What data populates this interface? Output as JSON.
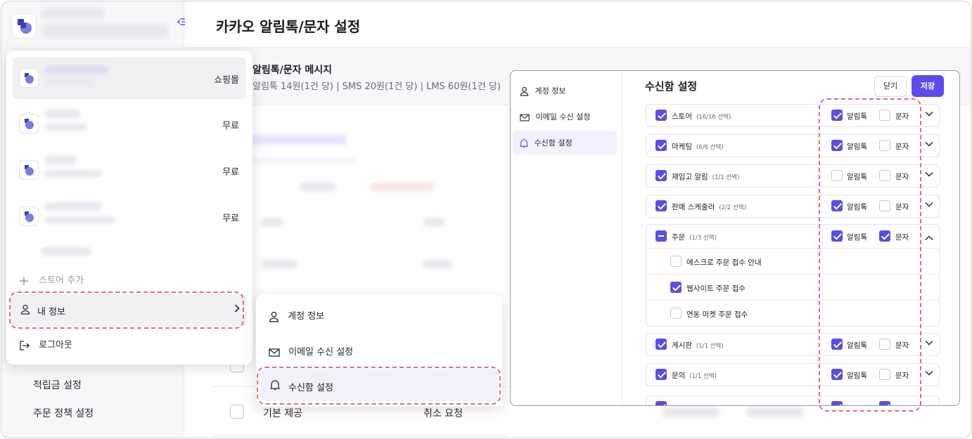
{
  "page": {
    "title": "카카오 알림톡/문자 설정"
  },
  "banner": {
    "heading": "알림톡/문자 메시지",
    "pricing": "알림톡 14원(1건 당) | SMS 20원(1건 당) | LMS 60원(1건 당)"
  },
  "left_nav": {
    "items": [
      "적립금 설정",
      "주문 정책 설정"
    ]
  },
  "background_table": {
    "row_labels": [
      "기본 제공",
      "취소 요청"
    ]
  },
  "store_dropdown": {
    "stores": [
      {
        "tag": "쇼핑몰",
        "selected": true
      },
      {
        "tag": "무료",
        "selected": false
      },
      {
        "tag": "무료",
        "selected": false
      },
      {
        "tag": "무료",
        "selected": false
      }
    ],
    "add_store": "스토어 추가",
    "my_info": "내 정보",
    "logout": "로그아웃"
  },
  "info_submenu": {
    "items": [
      "계정 정보",
      "이메일 수신 설정",
      "수신함 설정"
    ],
    "selected": "수신함 설정"
  },
  "settings_window": {
    "nav": [
      "계정 정보",
      "이메일 수신 설정",
      "수신함 설정"
    ],
    "active_nav": "수신함 설정",
    "title": "수신함 설정",
    "close_label": "닫기",
    "save_label": "저장",
    "col_alimtalk": "알림톡",
    "col_sms": "문자",
    "rows": [
      {
        "name": "스토어",
        "count": "(16/16 선택)",
        "main": "checked",
        "alimtalk": true,
        "sms": false
      },
      {
        "name": "마케팅",
        "count": "(6/6 선택)",
        "main": "checked",
        "alimtalk": true,
        "sms": false
      },
      {
        "name": "재입고 알림",
        "count": "(1/1 선택)",
        "main": "checked",
        "alimtalk": false,
        "sms": false
      },
      {
        "name": "판매 스케줄러",
        "count": "(2/2 선택)",
        "main": "checked",
        "alimtalk": true,
        "sms": false
      },
      {
        "name": "주문",
        "count": "(1/3 선택)",
        "main": "indeterminate",
        "alimtalk": true,
        "sms": true,
        "expanded": true
      },
      {
        "name": "게시판",
        "count": "(1/1 선택)",
        "main": "checked",
        "alimtalk": true,
        "sms": false
      },
      {
        "name": "문의",
        "count": "(1/1 선택)",
        "main": "checked",
        "alimtalk": true,
        "sms": false
      }
    ],
    "order_subitems": [
      {
        "label": "에스크로 주문 접수 안내",
        "checked": false
      },
      {
        "label": "웹사이트 주문 접수",
        "checked": true
      },
      {
        "label": "연동 마켓 주문 접수",
        "checked": false
      }
    ]
  },
  "colors": {
    "accent": "#5b4ee8",
    "highlight_dash": "#e06a82"
  }
}
